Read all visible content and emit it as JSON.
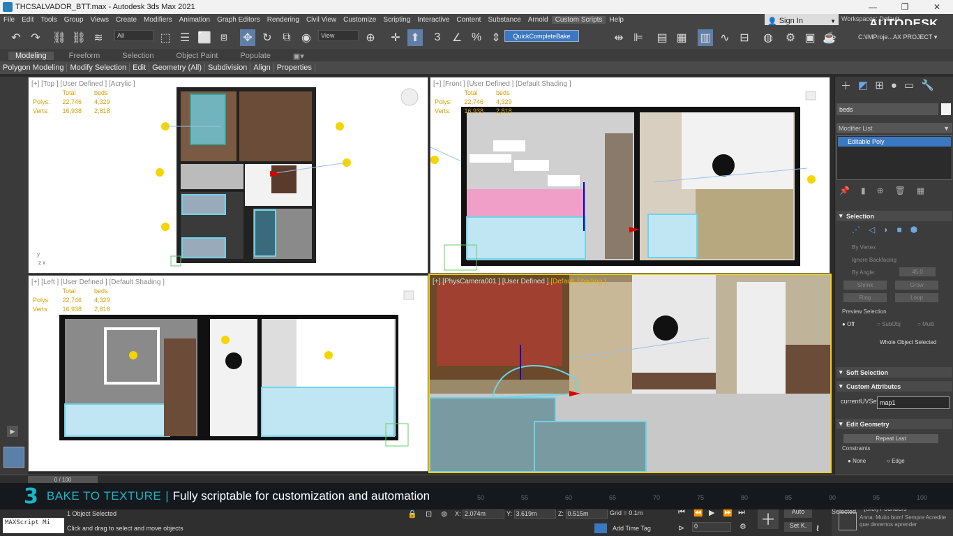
{
  "titlebar": {
    "title": "THCSALVADOR_BTT.max - Autodesk 3ds Max 2021"
  },
  "menubar": {
    "items": [
      "File",
      "Edit",
      "Tools",
      "Group",
      "Views",
      "Create",
      "Modifiers",
      "Animation",
      "Graph Editors",
      "Rendering",
      "Civil View",
      "Customize",
      "Scripting",
      "Interactive",
      "Content",
      "Substance",
      "Arnold",
      "Custom Scripts",
      "Help"
    ],
    "open_item": "Custom Scripts"
  },
  "dropdown": {
    "item": "QuickCompleteBake"
  },
  "account": {
    "signin": "Sign In",
    "workspaces": "Workspaces:",
    "workspace_value": "Default",
    "logo": "AUTODESK."
  },
  "toolbar": {
    "filter": "All",
    "refcoord": "View",
    "project_path": "C:\\IMProje...AX PROJECT"
  },
  "ribbon": {
    "tabs": [
      "Modeling",
      "Freeform",
      "Selection",
      "Object Paint",
      "Populate"
    ],
    "active_tab": "Modeling",
    "panels": [
      "Polygon Modeling",
      "Modify Selection",
      "Edit",
      "Geometry (All)",
      "Subdivision",
      "Align",
      "Properties"
    ]
  },
  "viewports": {
    "top": {
      "label_a": "[+] [Top ] [User Defined ] [Acrylic ]"
    },
    "front": {
      "label_a": "[+] [Front ] [User Defined ] [Default Shading ]"
    },
    "left": {
      "label_a": "[+] [Left ] [User Defined ] [Default Shading ]"
    },
    "camera": {
      "label_a": "[+] [PhysCamera001 ] [User Defined ]",
      "label_b": "[Default Shading ]"
    }
  },
  "stats": {
    "h_total": "Total",
    "h_sel": "beds",
    "polys_label": "Polys:",
    "polys_total": "22,746",
    "polys_sel": "4,329",
    "verts_label": "Verts:",
    "verts_total": "16,938",
    "verts_sel": "2,818"
  },
  "cmdpanel": {
    "object_name": "beds",
    "modifier_list": "Modifier List",
    "stack_item": "Editable Poly",
    "selection_title": "Selection",
    "by_vertex": "By Vertex",
    "ignore_backfacing": "Ignore Backfacing",
    "by_angle": "By Angle:",
    "angle_value": "45.0",
    "shrink": "Shrink",
    "grow": "Grow",
    "ring": "Ring",
    "loop": "Loop",
    "preview_selection": "Preview Selection",
    "off": "Off",
    "subobj": "SubObj",
    "multi": "Multi",
    "whole_object": "Whole Object Selected",
    "soft_selection": "Soft Selection",
    "custom_attributes": "Custom Attributes",
    "current_uvset_label": "currentUVSet",
    "current_uvset_value": "map1",
    "edit_geometry": "Edit Geometry",
    "repeat_last": "Repeat Last",
    "constraints": "Constraints",
    "none": "None",
    "edge": "Edge"
  },
  "timeslider": {
    "frame": "0 / 100"
  },
  "banner": {
    "heading": "BAKE TO TEXTURE",
    "separator": "|",
    "subtitle": "Fully scriptable for customization and automation"
  },
  "timeline_ticks": [
    "50",
    "55",
    "60",
    "65",
    "70",
    "75",
    "80",
    "85",
    "90",
    "95",
    "100"
  ],
  "status": {
    "maxscript": "MAXScript Mi",
    "selected": "1 Object Selected",
    "prompt": "Click and drag to select and move objects",
    "x_label": "X:",
    "x_value": "2.074m",
    "y_label": "Y:",
    "y_value": "3.619m",
    "z_label": "Z:",
    "z_value": "0.515m",
    "grid": "Grid = 0.1m",
    "add_time_tag": "Add Time Tag",
    "auto": "Auto",
    "setk": "Set K.",
    "selected_short": "Selected",
    "frame_spinner": "0"
  },
  "chat": {
    "name": "(orbi) Founders",
    "message": "Anna: Muito bom! Sempre Acredite que devemos aprender"
  },
  "colors": {
    "accent": "#3a78c2",
    "banner": "#1bb6c9",
    "selection": "#6fd3e8",
    "stats": "#d2a000"
  }
}
